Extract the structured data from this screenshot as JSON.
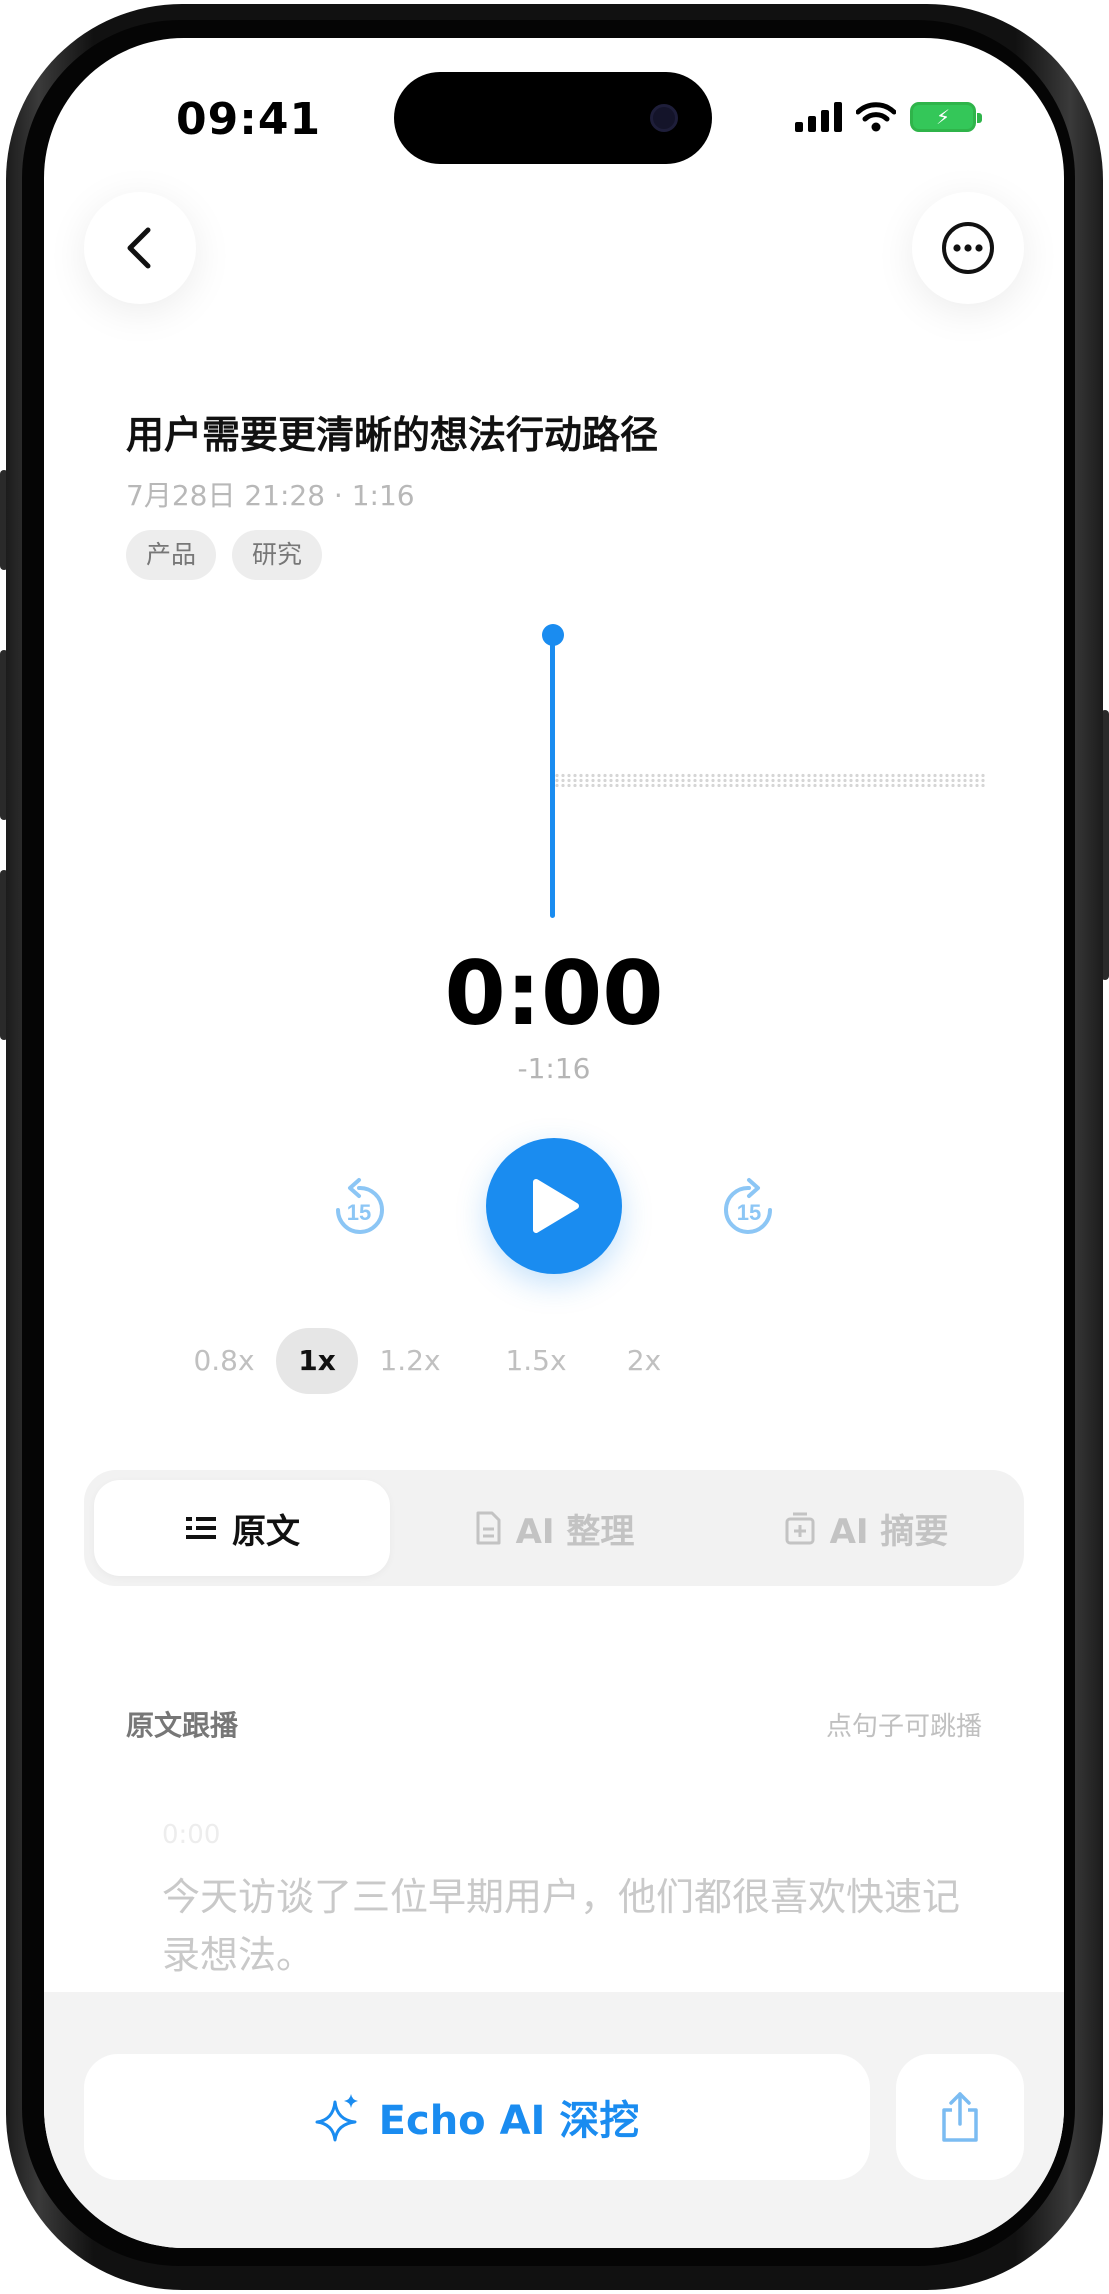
{
  "status_bar": {
    "time": "09:41"
  },
  "recording": {
    "title": "用户需要更清晰的想法行动路径",
    "meta": "7月28日 21:28 · 1:16",
    "tags": [
      "产品",
      "研究"
    ]
  },
  "player": {
    "current_time": "0:00",
    "remaining_time": "-1:16",
    "skip_back_seconds": "15",
    "skip_forward_seconds": "15",
    "speeds": [
      "0.8x",
      "1x",
      "1.2x",
      "1.5x",
      "2x"
    ],
    "active_speed": "1x"
  },
  "tabs": [
    {
      "label": "原文",
      "icon": "list-text-icon",
      "active": true
    },
    {
      "label": "AI 整理",
      "icon": "document-icon",
      "active": false
    },
    {
      "label": "AI 摘要",
      "icon": "summary-box-icon",
      "active": false
    }
  ],
  "transcript": {
    "section_label": "原文跟播",
    "hint": "点句子可跳播",
    "segments": [
      {
        "time": "0:00",
        "text": "今天访谈了三位早期用户，他们都很喜欢快速记录想法。"
      }
    ]
  },
  "bottom": {
    "echo_label": "Echo AI 深挖"
  },
  "colors": {
    "accent": "#1a8cf0",
    "battery": "#34c759"
  }
}
